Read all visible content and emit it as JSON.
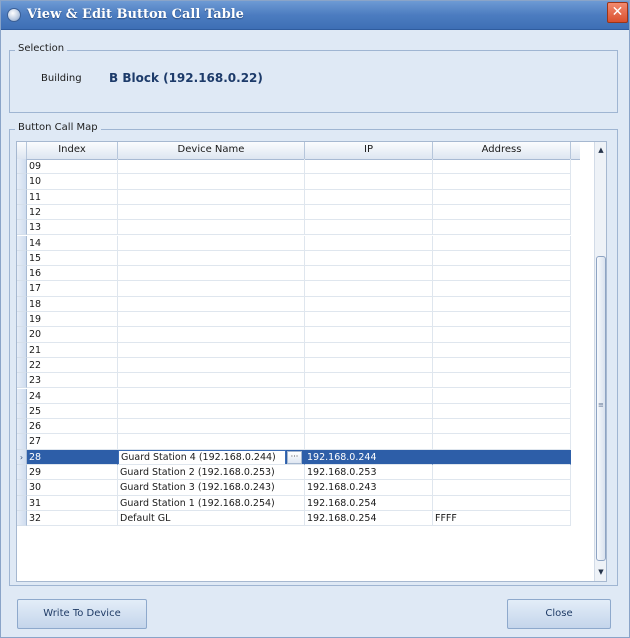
{
  "window": {
    "title": "View & Edit Button Call Table",
    "close_glyph": "✕"
  },
  "selection": {
    "legend": "Selection",
    "building_label": "Building",
    "building_value": "B Block (192.168.0.22)"
  },
  "map": {
    "legend": "Button Call Map",
    "columns": [
      "Index",
      "Device Name",
      "IP",
      "Address"
    ],
    "rows": [
      {
        "index": "09",
        "device": "",
        "ip": "",
        "address": ""
      },
      {
        "index": "10",
        "device": "",
        "ip": "",
        "address": ""
      },
      {
        "index": "11",
        "device": "",
        "ip": "",
        "address": ""
      },
      {
        "index": "12",
        "device": "",
        "ip": "",
        "address": ""
      },
      {
        "index": "13",
        "device": "",
        "ip": "",
        "address": ""
      },
      {
        "index": "14",
        "device": "",
        "ip": "",
        "address": ""
      },
      {
        "index": "15",
        "device": "",
        "ip": "",
        "address": ""
      },
      {
        "index": "16",
        "device": "",
        "ip": "",
        "address": ""
      },
      {
        "index": "17",
        "device": "",
        "ip": "",
        "address": ""
      },
      {
        "index": "18",
        "device": "",
        "ip": "",
        "address": ""
      },
      {
        "index": "19",
        "device": "",
        "ip": "",
        "address": ""
      },
      {
        "index": "20",
        "device": "",
        "ip": "",
        "address": ""
      },
      {
        "index": "21",
        "device": "",
        "ip": "",
        "address": ""
      },
      {
        "index": "22",
        "device": "",
        "ip": "",
        "address": ""
      },
      {
        "index": "23",
        "device": "",
        "ip": "",
        "address": ""
      },
      {
        "index": "24",
        "device": "",
        "ip": "",
        "address": ""
      },
      {
        "index": "25",
        "device": "",
        "ip": "",
        "address": ""
      },
      {
        "index": "26",
        "device": "",
        "ip": "",
        "address": ""
      },
      {
        "index": "27",
        "device": "",
        "ip": "",
        "address": ""
      },
      {
        "index": "28",
        "device": "Guard Station 4 (192.168.0.244)",
        "ip": "192.168.0.244",
        "address": "",
        "selected": true,
        "editing": true,
        "ellipsis": "···"
      },
      {
        "index": "29",
        "device": "Guard Station 2 (192.168.0.253)",
        "ip": "192.168.0.253",
        "address": ""
      },
      {
        "index": "30",
        "device": "Guard Station 3 (192.168.0.243)",
        "ip": "192.168.0.243",
        "address": ""
      },
      {
        "index": "31",
        "device": "Guard Station 1 (192.168.0.254)",
        "ip": "192.168.0.254",
        "address": ""
      },
      {
        "index": "32",
        "device": "Default GL",
        "ip": "192.168.0.254",
        "address": "FFFF"
      }
    ],
    "row_indicator": "›",
    "scroll_up": "▲",
    "scroll_down": "▼",
    "scroll_grip": "≡"
  },
  "buttons": {
    "write": "Write To Device",
    "close": "Close"
  },
  "colors": {
    "title_bar": "#4c7cc0",
    "selected_row": "#2d5ea8",
    "window_bg": "#dfe9f5"
  }
}
